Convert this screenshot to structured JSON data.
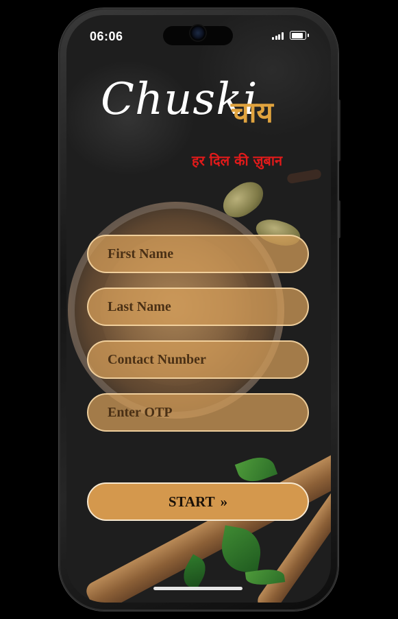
{
  "status_bar": {
    "time": "06:06",
    "icons": [
      "signal-icon",
      "battery-icon"
    ]
  },
  "brand": {
    "name": "Chuski",
    "name_hindi": "चाय",
    "tagline": "हर दिल की ज़ुबान"
  },
  "form": {
    "first_name_placeholder": "First Name",
    "last_name_placeholder": "Last Name",
    "contact_placeholder": "Contact Number",
    "otp_placeholder": "Enter OTP",
    "start_label": "START",
    "start_icon": "»"
  },
  "colors": {
    "accent": "#d4984d",
    "brand_hindi": "#e0a33e",
    "tagline": "#e21a1a"
  }
}
